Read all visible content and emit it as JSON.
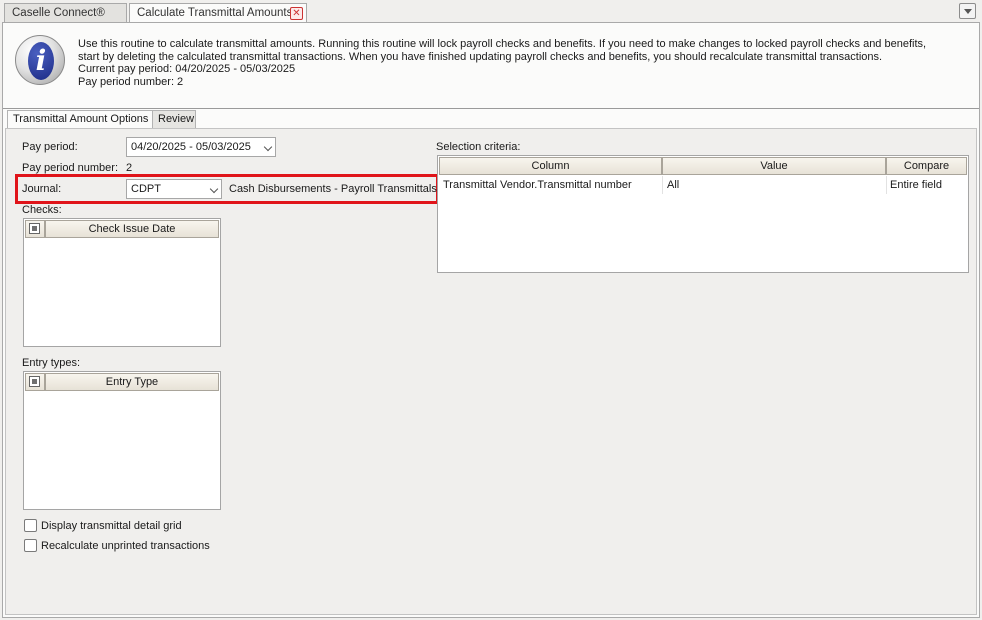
{
  "tabs": {
    "caselle": "Caselle Connect®",
    "calculate": "Calculate Transmittal Amounts"
  },
  "info": {
    "line1": "Use this routine to calculate transmittal amounts. Running this routine will lock payroll checks and benefits. If you need to make changes to locked payroll checks and benefits,",
    "line2": "start by deleting the calculated transmittal transactions. When you have finished updating payroll checks and benefits, you should recalculate transmittal transactions.",
    "line3": "Current pay period: 04/20/2025 - 05/03/2025",
    "line4": "Pay period number: 2"
  },
  "subtabs": {
    "options": "Transmittal Amount Options",
    "review": "Review"
  },
  "form": {
    "pay_period_label": "Pay period:",
    "pay_period_value": "04/20/2025 - 05/03/2025",
    "pay_period_number_label": "Pay period number:",
    "pay_period_number_value": "2",
    "journal_label": "Journal:",
    "journal_value": "CDPT",
    "journal_description": "Cash Disbursements - Payroll Transmittals",
    "checks_label": "Checks:",
    "checks_header": "Check Issue Date",
    "entry_types_label": "Entry types:",
    "entry_types_header": "Entry Type",
    "display_detail_label": "Display transmittal detail grid",
    "recalc_label": "Recalculate unprinted transactions"
  },
  "selection": {
    "label": "Selection criteria:",
    "headers": {
      "column": "Column",
      "value": "Value",
      "compare": "Compare"
    },
    "rows": [
      {
        "column": "Transmittal Vendor.Transmittal number",
        "value": "All",
        "compare": "Entire field"
      }
    ]
  },
  "colors": {
    "highlight": "#e0141a"
  }
}
